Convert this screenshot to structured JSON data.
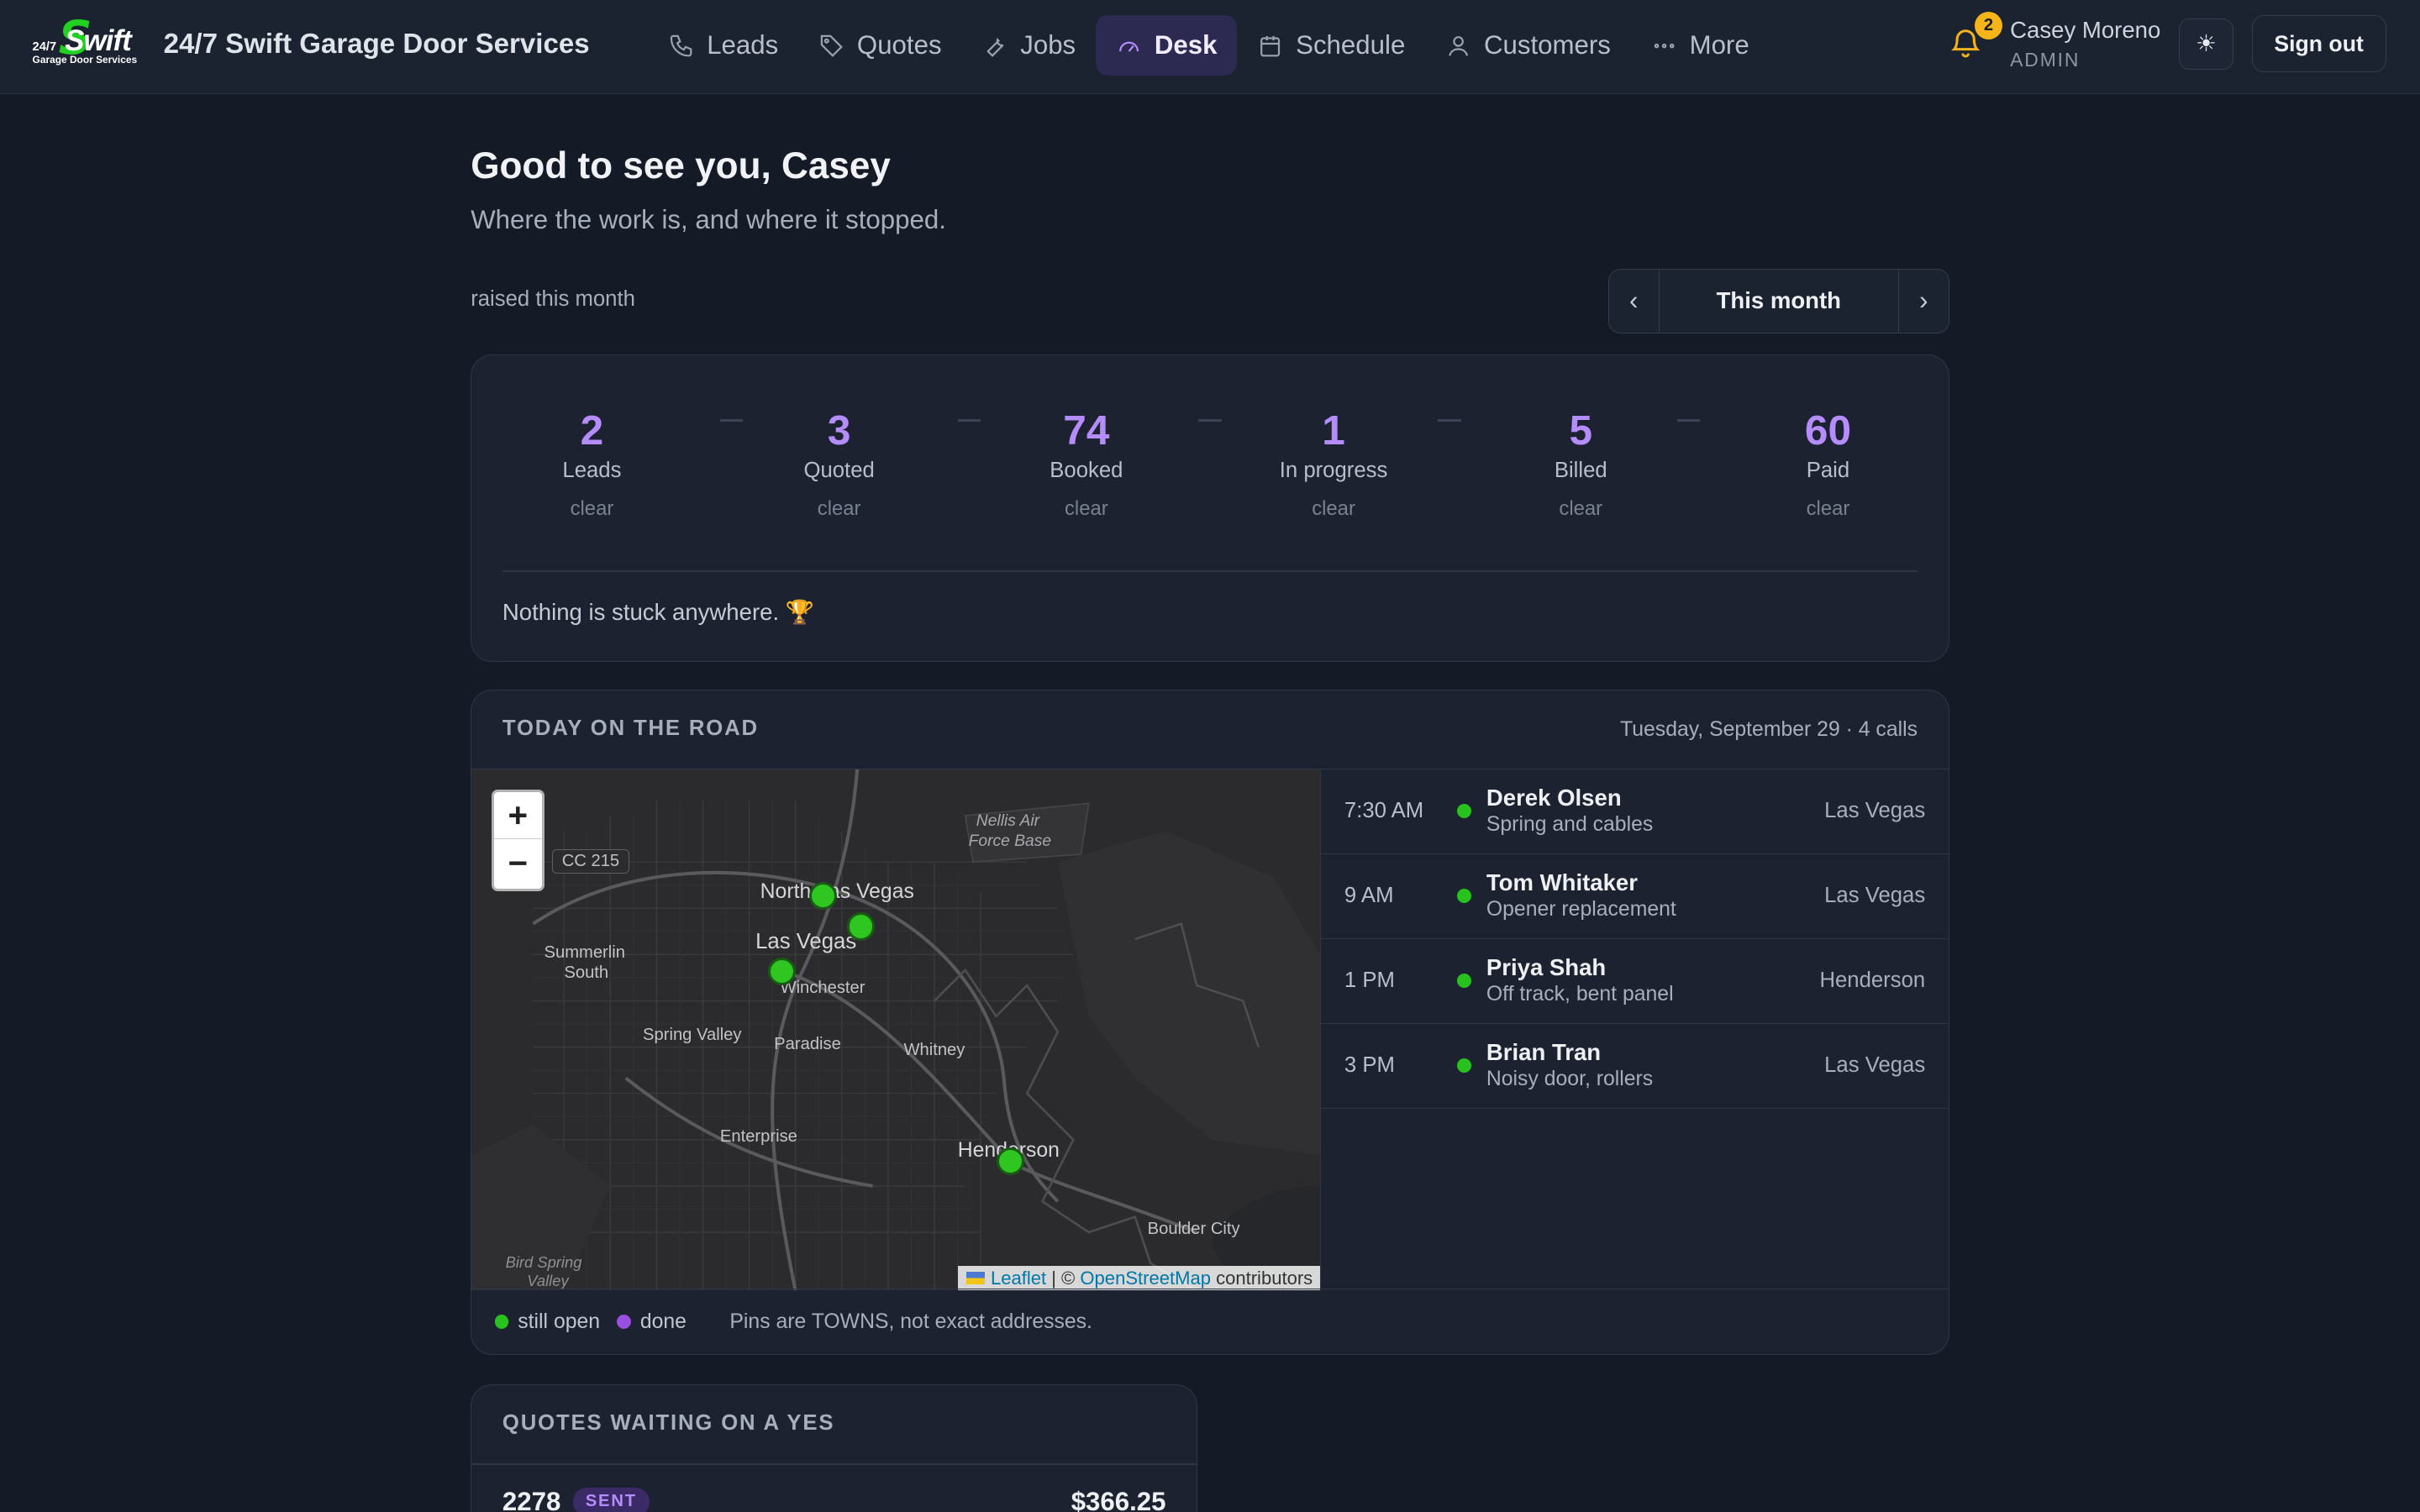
{
  "brand": {
    "logo_text": "Swift",
    "logo_prefix": "24/7",
    "logo_sub": "Garage Door Services",
    "name": "24/7 Swift Garage Door Services"
  },
  "nav": [
    {
      "label": "Leads",
      "icon": "phone-icon"
    },
    {
      "label": "Quotes",
      "icon": "tag-icon"
    },
    {
      "label": "Jobs",
      "icon": "wrench-icon"
    },
    {
      "label": "Desk",
      "icon": "gauge-icon",
      "active": true
    },
    {
      "label": "Schedule",
      "icon": "calendar-icon"
    },
    {
      "label": "Customers",
      "icon": "user-icon"
    },
    {
      "label": "More",
      "icon": "dots-icon"
    }
  ],
  "header": {
    "notification_count": "2",
    "user_name": "Casey Moreno",
    "user_role": "ADMIN",
    "theme_icon": "☀",
    "sign_out": "Sign out"
  },
  "page": {
    "greeting": "Good to see you, Casey",
    "subtitle": "Where the work is, and where it stopped.",
    "raised_label": "raised this month",
    "period": {
      "prev": "‹",
      "label": "This month",
      "next": "›"
    }
  },
  "funnel": {
    "stages": [
      {
        "value": "2",
        "label": "Leads",
        "status": "clear"
      },
      {
        "value": "3",
        "label": "Quoted",
        "status": "clear"
      },
      {
        "value": "74",
        "label": "Booked",
        "status": "clear"
      },
      {
        "value": "1",
        "label": "In progress",
        "status": "clear"
      },
      {
        "value": "5",
        "label": "Billed",
        "status": "clear"
      },
      {
        "value": "60",
        "label": "Paid",
        "status": "clear"
      }
    ],
    "message": "Nothing is stuck anywhere. 🏆"
  },
  "road": {
    "title": "TODAY ON THE ROAD",
    "date_summary": "Tuesday, September 29 · 4 calls",
    "map": {
      "zoom_in": "+",
      "zoom_out": "−",
      "attribution_leaflet": "Leaflet",
      "attribution_sep": " | © ",
      "attribution_osm": "OpenStreetMap",
      "attribution_tail": " contributors",
      "labels": [
        "CC 215",
        "Nellis Air",
        "Force Base",
        "North Las Vegas",
        "Las Vegas",
        "Summerlin",
        "South",
        "Winchester",
        "Spring Valley",
        "Paradise",
        "Whitney",
        "Enterprise",
        "Henderson",
        "Boulder City",
        "Bird Spring",
        "Valley"
      ]
    },
    "calls": [
      {
        "time": "7:30 AM",
        "name": "Derek Olsen",
        "issue": "Spring and cables",
        "town": "Las Vegas"
      },
      {
        "time": "9 AM",
        "name": "Tom Whitaker",
        "issue": "Opener replacement",
        "town": "Las Vegas"
      },
      {
        "time": "1 PM",
        "name": "Priya Shah",
        "issue": "Off track, bent panel",
        "town": "Henderson"
      },
      {
        "time": "3 PM",
        "name": "Brian Tran",
        "issue": "Noisy door, rollers",
        "town": "Las Vegas"
      }
    ],
    "legend": {
      "open_label": "still open",
      "open_color": "#27c21d",
      "done_label": "done",
      "done_color": "#9a4fe0",
      "note": "Pins are TOWNS, not exact addresses."
    }
  },
  "quotes": {
    "title": "QUOTES WAITING ON A YES",
    "rows": [
      {
        "id": "2278",
        "status": "SENT",
        "amount": "$366.25"
      }
    ]
  },
  "colors": {
    "accent": "#b58cfb",
    "background": "#141a26",
    "card": "#1c2230",
    "open_pin": "#27c21d",
    "bell": "#f2b41c"
  }
}
